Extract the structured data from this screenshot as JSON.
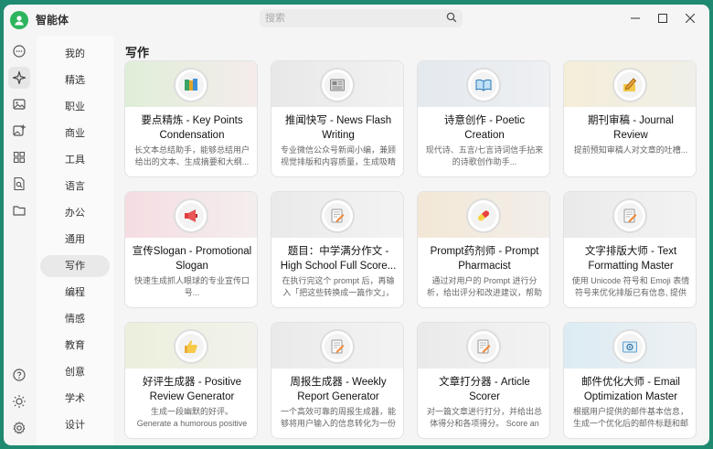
{
  "app": {
    "title": "智能体"
  },
  "search": {
    "placeholder": "搜索"
  },
  "window_controls": [
    "minimize-icon",
    "maximize-icon",
    "close-icon"
  ],
  "rail": {
    "items": [
      {
        "name": "chat-icon"
      },
      {
        "name": "agent-sparkle-icon",
        "active": true
      },
      {
        "name": "image-icon"
      },
      {
        "name": "image-add-icon"
      },
      {
        "name": "grid-apps-icon"
      },
      {
        "name": "document-search-icon"
      },
      {
        "name": "folder-icon"
      }
    ],
    "bottom": [
      {
        "name": "help-icon"
      },
      {
        "name": "theme-sun-icon"
      },
      {
        "name": "settings-icon"
      }
    ]
  },
  "categories": [
    {
      "label": "我的"
    },
    {
      "label": "精选"
    },
    {
      "label": "职业"
    },
    {
      "label": "商业"
    },
    {
      "label": "工具"
    },
    {
      "label": "语言"
    },
    {
      "label": "办公"
    },
    {
      "label": "通用"
    },
    {
      "label": "写作",
      "active": true
    },
    {
      "label": "编程"
    },
    {
      "label": "情感"
    },
    {
      "label": "教育"
    },
    {
      "label": "创意"
    },
    {
      "label": "学术"
    },
    {
      "label": "设计"
    }
  ],
  "section": {
    "title": "写作"
  },
  "cards": [
    {
      "title": "要点精炼 - Key Points Condensation",
      "desc": "长文本总结助手，能够总结用户给出的文本、生成摘要和大纲...",
      "icon": "books-icon",
      "band": "#e6efe0"
    },
    {
      "title": "推闻快写 - News Flash Writing",
      "desc": "专业微信公众号新闻小编，兼顾视觉排版和内容质量，生成吸睛内...",
      "icon": "newspaper-icon",
      "band": "#ececec"
    },
    {
      "title": "诗意创作 - Poetic Creation",
      "desc": "现代诗、五言/七言诗词信手拈来的诗歌创作助手...",
      "icon": "open-book-icon",
      "band": "#e8ecf0"
    },
    {
      "title": "期刊审稿 - Journal Review",
      "desc": "提前预知审稿人对文章的吐槽...",
      "icon": "pencil-note-icon",
      "band": "#f3eedf"
    },
    {
      "title": "宣传Slogan - Promotional Slogan",
      "desc": "快速生成抓人眼球的专业宣传口号...",
      "icon": "megaphone-icon",
      "band": "#f6e3e6"
    },
    {
      "title": "题目：中学满分作文 - High School Full Score...",
      "desc": "在执行完这个 prompt 后，再输入「把这些转换成一篇作文」，查...",
      "icon": "memo-icon",
      "band": "#ececec"
    },
    {
      "title": "Prompt药剂师 - Prompt Pharmacist",
      "desc": "通过对用户的 Prompt 进行分析，给出评分和改进建议，帮助用户提...",
      "icon": "pill-icon",
      "band": "#f3ece0"
    },
    {
      "title": "文字排版大师 - Text Formatting Master",
      "desc": "使用 Unicode 符号和 Emoji 表情符号来优化排版已有信息, 提供更好...",
      "icon": "memo-icon",
      "band": "#ececec"
    },
    {
      "title": "好评生成器 - Positive Review Generator",
      "desc": "生成一段幽默的好评。 Generate a humorous positive review....",
      "icon": "thumbs-up-icon",
      "band": "#eef0e4"
    },
    {
      "title": "周报生成器 - Weekly Report Generator",
      "desc": "一个高效可靠的周报生成器，能够将用户输入的信息转化为一份高...",
      "icon": "memo-icon",
      "band": "#ececec"
    },
    {
      "title": "文章打分器 - Article Scorer",
      "desc": "对一篇文章进行打分，并给出总体得分和各项得分。 Score an articl...",
      "icon": "memo-icon",
      "band": "#ececec"
    },
    {
      "title": "邮件优化大师 - Email Optimization Master",
      "desc": "根据用户提供的邮件基本信息，生成一个优化后的邮件标题和邮件...",
      "icon": "email-icon",
      "band": "#e3edf3"
    }
  ]
}
